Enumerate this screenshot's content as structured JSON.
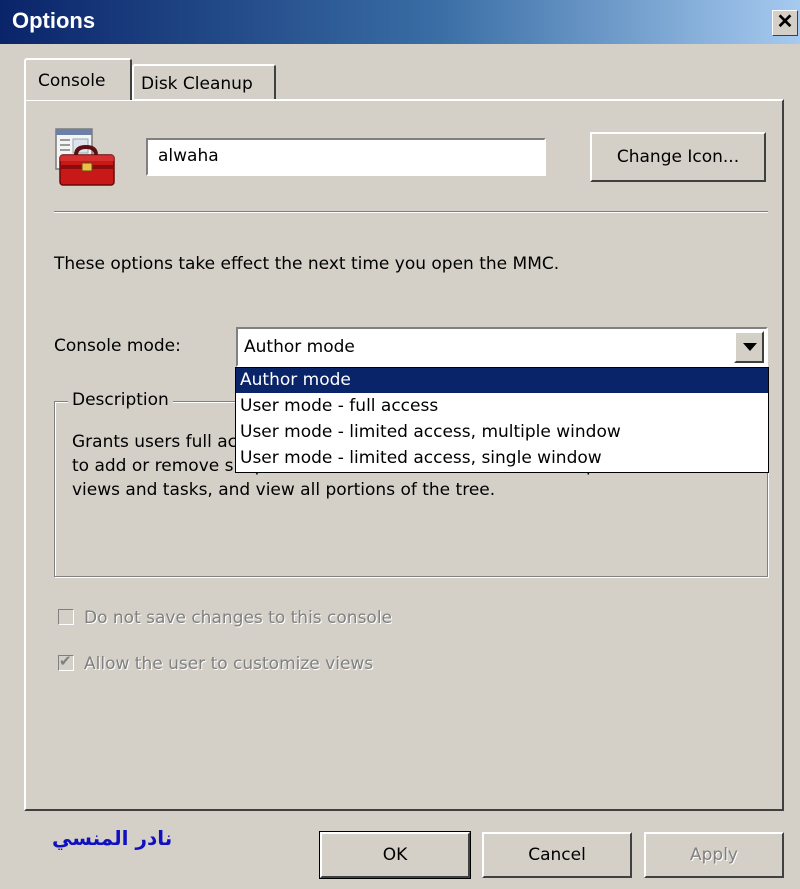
{
  "window": {
    "title": "Options",
    "close_glyph": "✕"
  },
  "tabs": [
    {
      "label": "Console",
      "selected": true
    },
    {
      "label": "Disk Cleanup",
      "selected": false
    }
  ],
  "console": {
    "icon": "toolbox-console-icon",
    "name_value": "alwaha",
    "change_icon_label": "Change Icon...",
    "info_text": "These options take effect the next time you open the MMC.",
    "mode_label": "Console mode:",
    "mode_value": "Author mode",
    "mode_options": [
      "Author mode",
      "User mode - full access",
      "User mode - limited access, multiple window",
      "User mode - limited access, single window"
    ],
    "description_title": "Description",
    "description_lines": [
      "Grants users full access to all MMC functionality, including the ability",
      "to add or remove snap-ins, create new windows, create taskpad",
      "views and tasks, and view all portions of the tree."
    ],
    "check_no_save": {
      "label": "Do not save changes to this console",
      "checked": false,
      "enabled": false
    },
    "check_customize": {
      "label": "Allow the user to customize views",
      "checked": true,
      "enabled": false
    }
  },
  "signature": "نادر المنسي",
  "buttons": {
    "ok": "OK",
    "cancel": "Cancel",
    "apply": "Apply"
  },
  "colors": {
    "selection": "#0a246a",
    "dialog_bg": "#d4d0c8",
    "signature": "#1010c0"
  }
}
